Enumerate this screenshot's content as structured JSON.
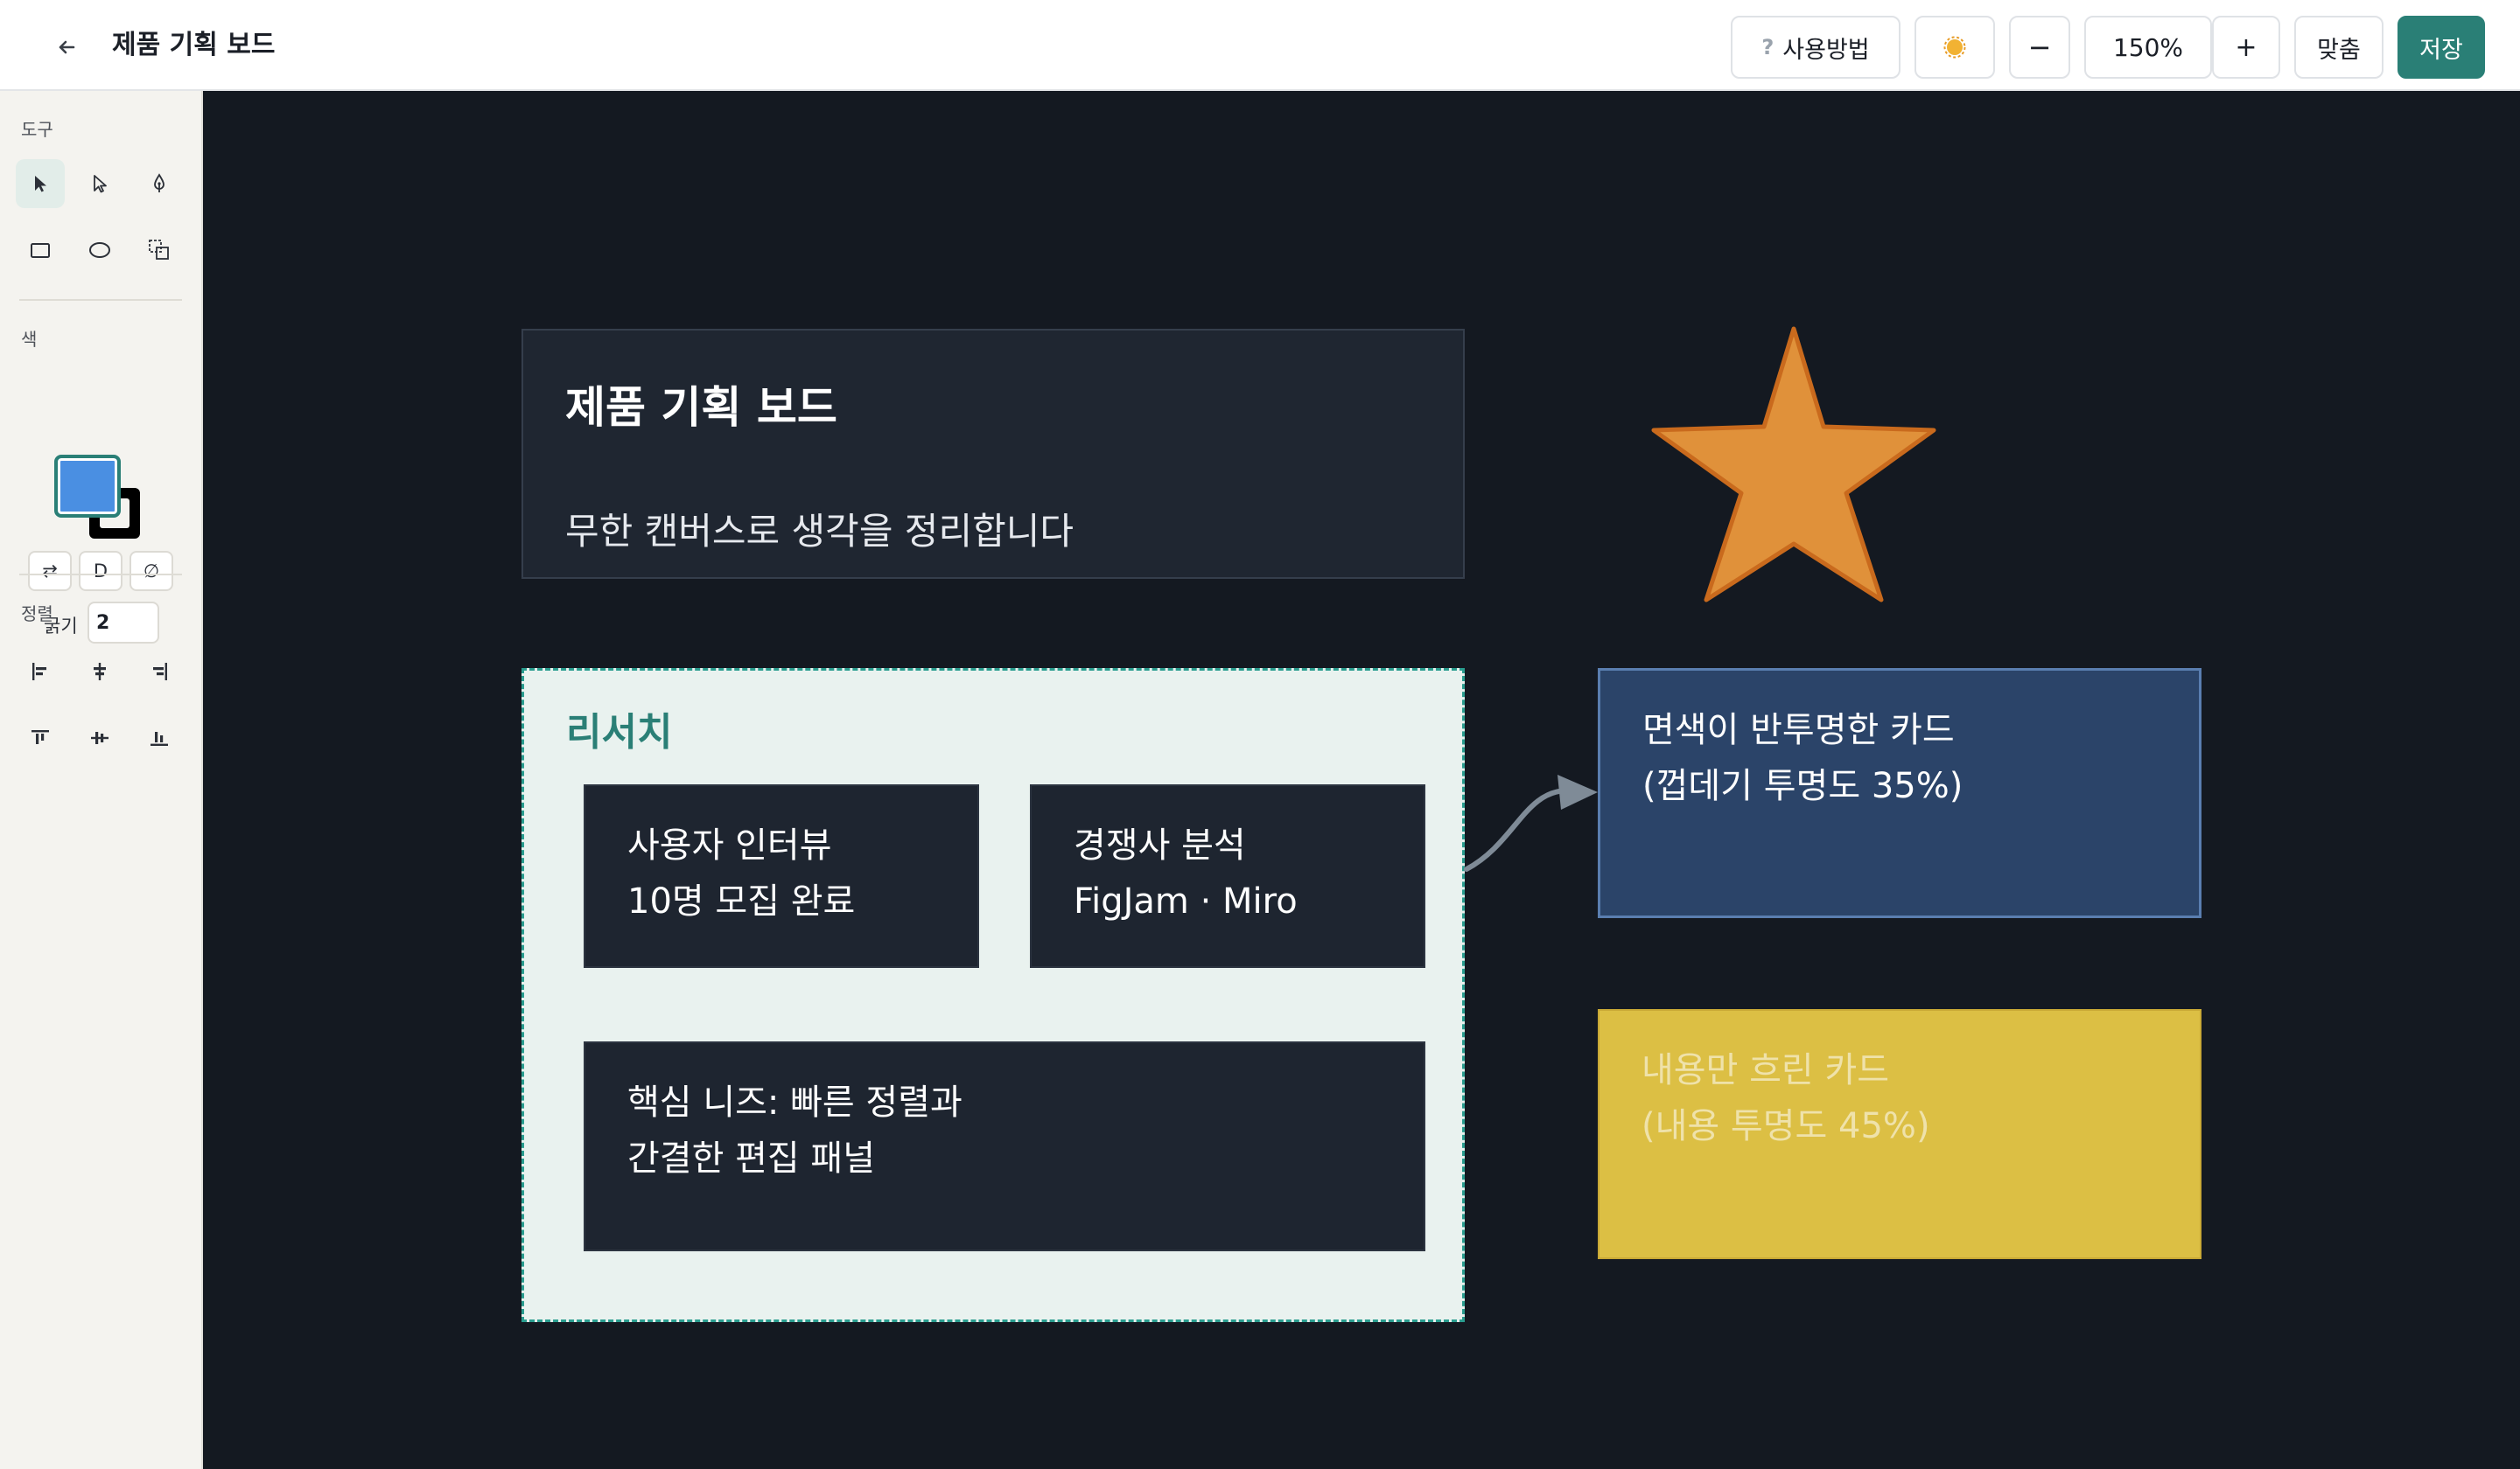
{
  "header": {
    "title": "제품 기획 보드",
    "help_label": "사용방법",
    "zoom_out_label": "−",
    "zoom_level": "150%",
    "zoom_in_label": "+",
    "fit_label": "맞춤",
    "save_label": "저장"
  },
  "sidebar": {
    "tools_label": "도구",
    "color_label": "색",
    "swap_label": "⇄",
    "default_label": "D",
    "none_label": "∅",
    "stroke_width_label": "굵기",
    "stroke_width_value": "2",
    "align_label": "정렬",
    "colors": {
      "fill": "#4a8fe2",
      "stroke": "#000000",
      "accent": "#2a7f76"
    }
  },
  "canvas": {
    "title_card": {
      "heading": "제품 기획 보드",
      "subtitle": "무한 캔버스로 생각을 정리합니다"
    },
    "research_frame": {
      "title": "리서치",
      "cards": [
        {
          "line1": "사용자 인터뷰",
          "line2": "10명 모집 완료"
        },
        {
          "line1": "경쟁사 분석",
          "line2": "FigJam · Miro"
        },
        {
          "line1": "핵심 니즈: 빠른 정렬과",
          "line2": "간결한 편집 패널"
        }
      ]
    },
    "translucent_card": {
      "line1": "면색이 반투명한 카드",
      "line2": "(껍데기 투명도 35%)"
    },
    "faded_card": {
      "line1": "내용만 흐린 카드",
      "line2": "(내용 투명도 45%)"
    },
    "star_color": "#e0913a"
  }
}
